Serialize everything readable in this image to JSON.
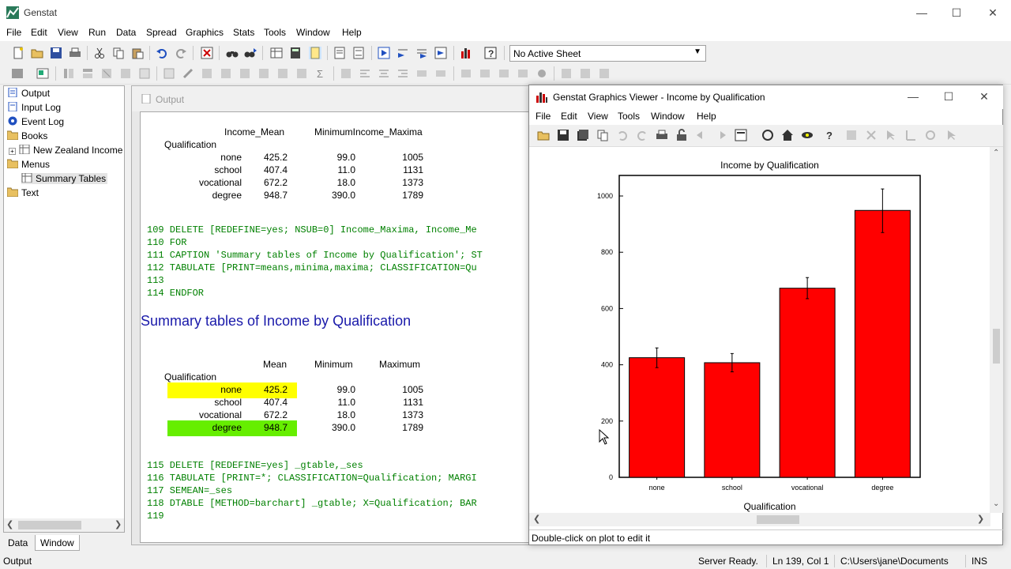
{
  "app": {
    "title": "Genstat"
  },
  "menubar": [
    "File",
    "Edit",
    "View",
    "Run",
    "Data",
    "Spread",
    "Graphics",
    "Stats",
    "Tools",
    "Window",
    "Help"
  ],
  "toolbar": {
    "sheet_select_value": "No Active Sheet"
  },
  "tree": {
    "items": [
      {
        "label": "Output",
        "icon": "page-icon"
      },
      {
        "label": "Input Log",
        "icon": "page-icon"
      },
      {
        "label": "Event Log",
        "icon": "globe-icon"
      },
      {
        "label": "Books",
        "icon": "folder-icon"
      },
      {
        "label": "New Zealand Income",
        "icon": "sheet-icon"
      },
      {
        "label": "Menus",
        "icon": "folder-icon"
      },
      {
        "label": "Summary Tables",
        "icon": "sheet-icon"
      },
      {
        "label": "Text",
        "icon": "folder-icon"
      }
    ]
  },
  "bottom_tabs": [
    "Data",
    "Window"
  ],
  "output": {
    "title": "Output",
    "table1": {
      "headers": [
        "Income_Mean",
        "MinimumIncome_Maxima"
      ],
      "row_header": "Qualification",
      "rows": [
        {
          "label": "none",
          "mean": "425.2",
          "min": "99.0",
          "max": "1005"
        },
        {
          "label": "school",
          "mean": "407.4",
          "min": "11.0",
          "max": "1131"
        },
        {
          "label": "vocational",
          "mean": "672.2",
          "min": "18.0",
          "max": "1373"
        },
        {
          "label": "degree",
          "mean": "948.7",
          "min": "390.0",
          "max": "1789"
        }
      ]
    },
    "code1": [
      "109  DELETE [REDEFINE=yes; NSUB=0] Income_Maxima, Income_Me",
      "110  FOR",
      "111  CAPTION 'Summary tables of Income by Qualification'; ST",
      "112  TABULATE [PRINT=means,minima,maxima; CLASSIFICATION=Qu",
      "113",
      "114  ENDFOR"
    ],
    "heading": "Summary tables of Income by Qualification",
    "table2": {
      "headers": [
        "Mean",
        "Minimum",
        "Maximum"
      ],
      "row_header": "Qualification",
      "rows": [
        {
          "label": "none",
          "mean": "425.2",
          "min": "99.0",
          "max": "1005"
        },
        {
          "label": "school",
          "mean": "407.4",
          "min": "11.0",
          "max": "1131"
        },
        {
          "label": "vocational",
          "mean": "672.2",
          "min": "18.0",
          "max": "1373"
        },
        {
          "label": "degree",
          "mean": "948.7",
          "min": "390.0",
          "max": "1789"
        }
      ]
    },
    "code2": [
      "115  DELETE [REDEFINE=yes] _gtable,_ses",
      "116  TABULATE [PRINT=*; CLASSIFICATION=Qualification; MARGI",
      "117   SEMEAN=_ses",
      "118  DTABLE [METHOD=barchart] _gtable; X=Qualification; BAR",
      "119"
    ]
  },
  "viewer": {
    "title": "Genstat Graphics Viewer - Income by Qualification",
    "menu": [
      "File",
      "Edit",
      "View",
      "Tools",
      "Window",
      "Help"
    ],
    "status": "Double-click on plot to edit it"
  },
  "chart_data": {
    "type": "bar",
    "title": "Income by Qualification",
    "xlabel": "Qualification",
    "ylabel": "",
    "categories": [
      "none",
      "school",
      "vocational",
      "degree"
    ],
    "values": [
      425.2,
      407.4,
      672.2,
      948.7
    ],
    "error_upper": [
      460,
      440,
      710,
      1025
    ],
    "error_lower": [
      390,
      375,
      635,
      870
    ],
    "ylim": [
      0,
      1000
    ],
    "yticks": [
      "0",
      "200",
      "400",
      "600",
      "800",
      "1000"
    ],
    "bar_color": "#ff0000"
  },
  "statusbar": {
    "left": "Output",
    "server": "Server Ready.",
    "position": "Ln 139, Col 1",
    "path": "C:\\Users\\jane\\Documents",
    "mode": "INS"
  }
}
